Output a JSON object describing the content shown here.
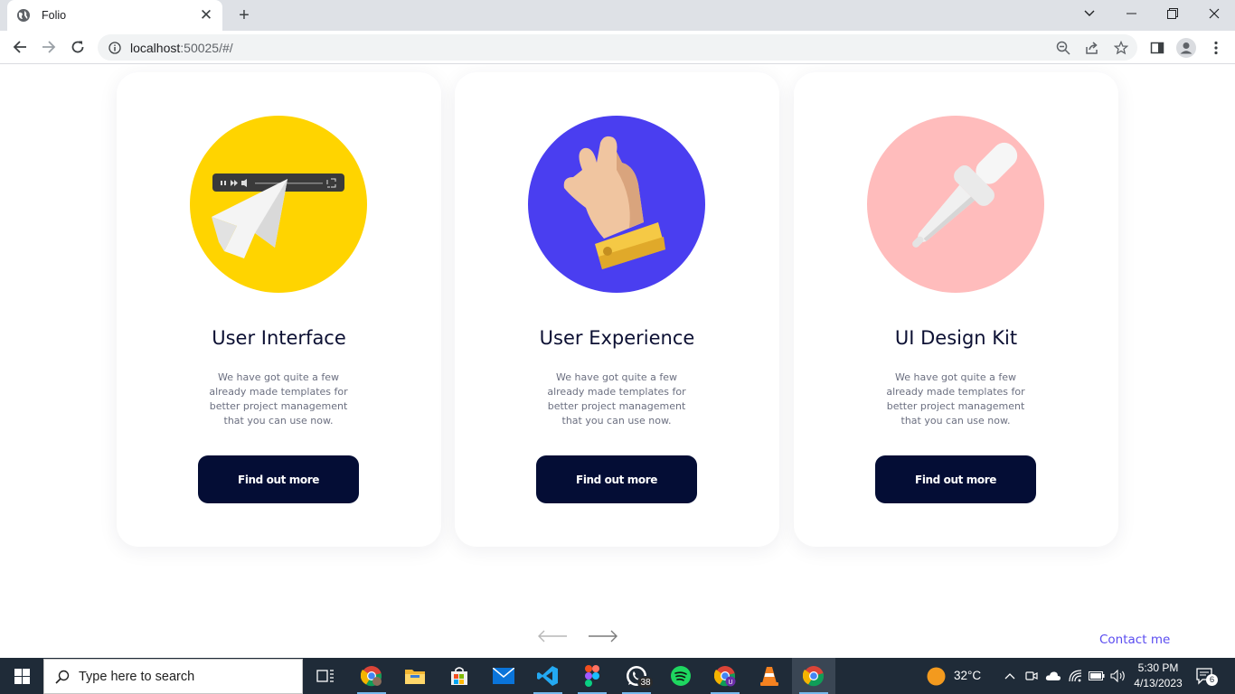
{
  "browser": {
    "tab_title": "Folio",
    "url_host": "localhost",
    "url_rest": ":50025/#/"
  },
  "cards": [
    {
      "title": "User Interface",
      "description": "We have got quite a few already made templates for better project management that you can use now.",
      "button": "Find out more",
      "circle_color": "#ffd400"
    },
    {
      "title": "User Experience",
      "description": "We have got quite a few already made templates for better project management that you can use now.",
      "button": "Find out more",
      "circle_color": "#4a3ef0"
    },
    {
      "title": "UI Design Kit",
      "description": "We have got quite a few already made templates for better project management that you can use now.",
      "button": "Find out more",
      "circle_color": "#ffbcbc"
    }
  ],
  "footer": {
    "contact": "Contact me"
  },
  "taskbar": {
    "search_placeholder": "Type here to search",
    "whatsapp_badge": "38",
    "temperature": "32°C",
    "time": "5:30 PM",
    "date": "4/13/2023",
    "notifications": "6"
  },
  "colors": {
    "accent": "#5a4cf0",
    "button": "#040d35",
    "title": "#0c1033"
  }
}
